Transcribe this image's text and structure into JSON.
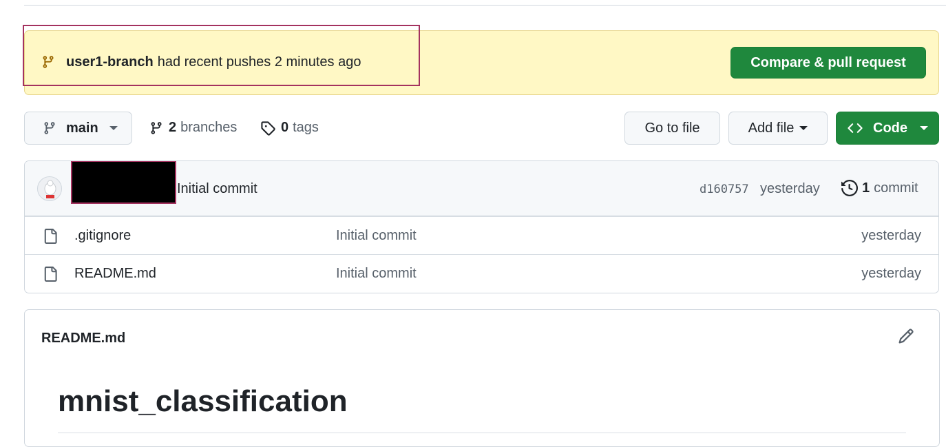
{
  "banner": {
    "branch_name": "user1-branch",
    "message": "had recent pushes 2 minutes ago",
    "compare_button": "Compare & pull request",
    "icon": "git-branch-icon",
    "background_color": "#fff8c5"
  },
  "toolbar": {
    "current_branch": "main",
    "branches_count": "2",
    "branches_label": "branches",
    "tags_count": "0",
    "tags_label": "tags",
    "go_to_file": "Go to file",
    "add_file": "Add file",
    "code": "Code",
    "accent_color": "#1f883d"
  },
  "latest_commit": {
    "message": "Initial commit",
    "sha": "d160757",
    "time": "yesterday",
    "commit_count": "1",
    "commit_label": "commit"
  },
  "files": [
    {
      "name": ".gitignore",
      "message": "Initial commit",
      "time": "yesterday",
      "icon": "file-icon"
    },
    {
      "name": "README.md",
      "message": "Initial commit",
      "time": "yesterday",
      "icon": "file-icon"
    }
  ],
  "readme": {
    "file_name": "README.md",
    "heading": "mnist_classification"
  }
}
